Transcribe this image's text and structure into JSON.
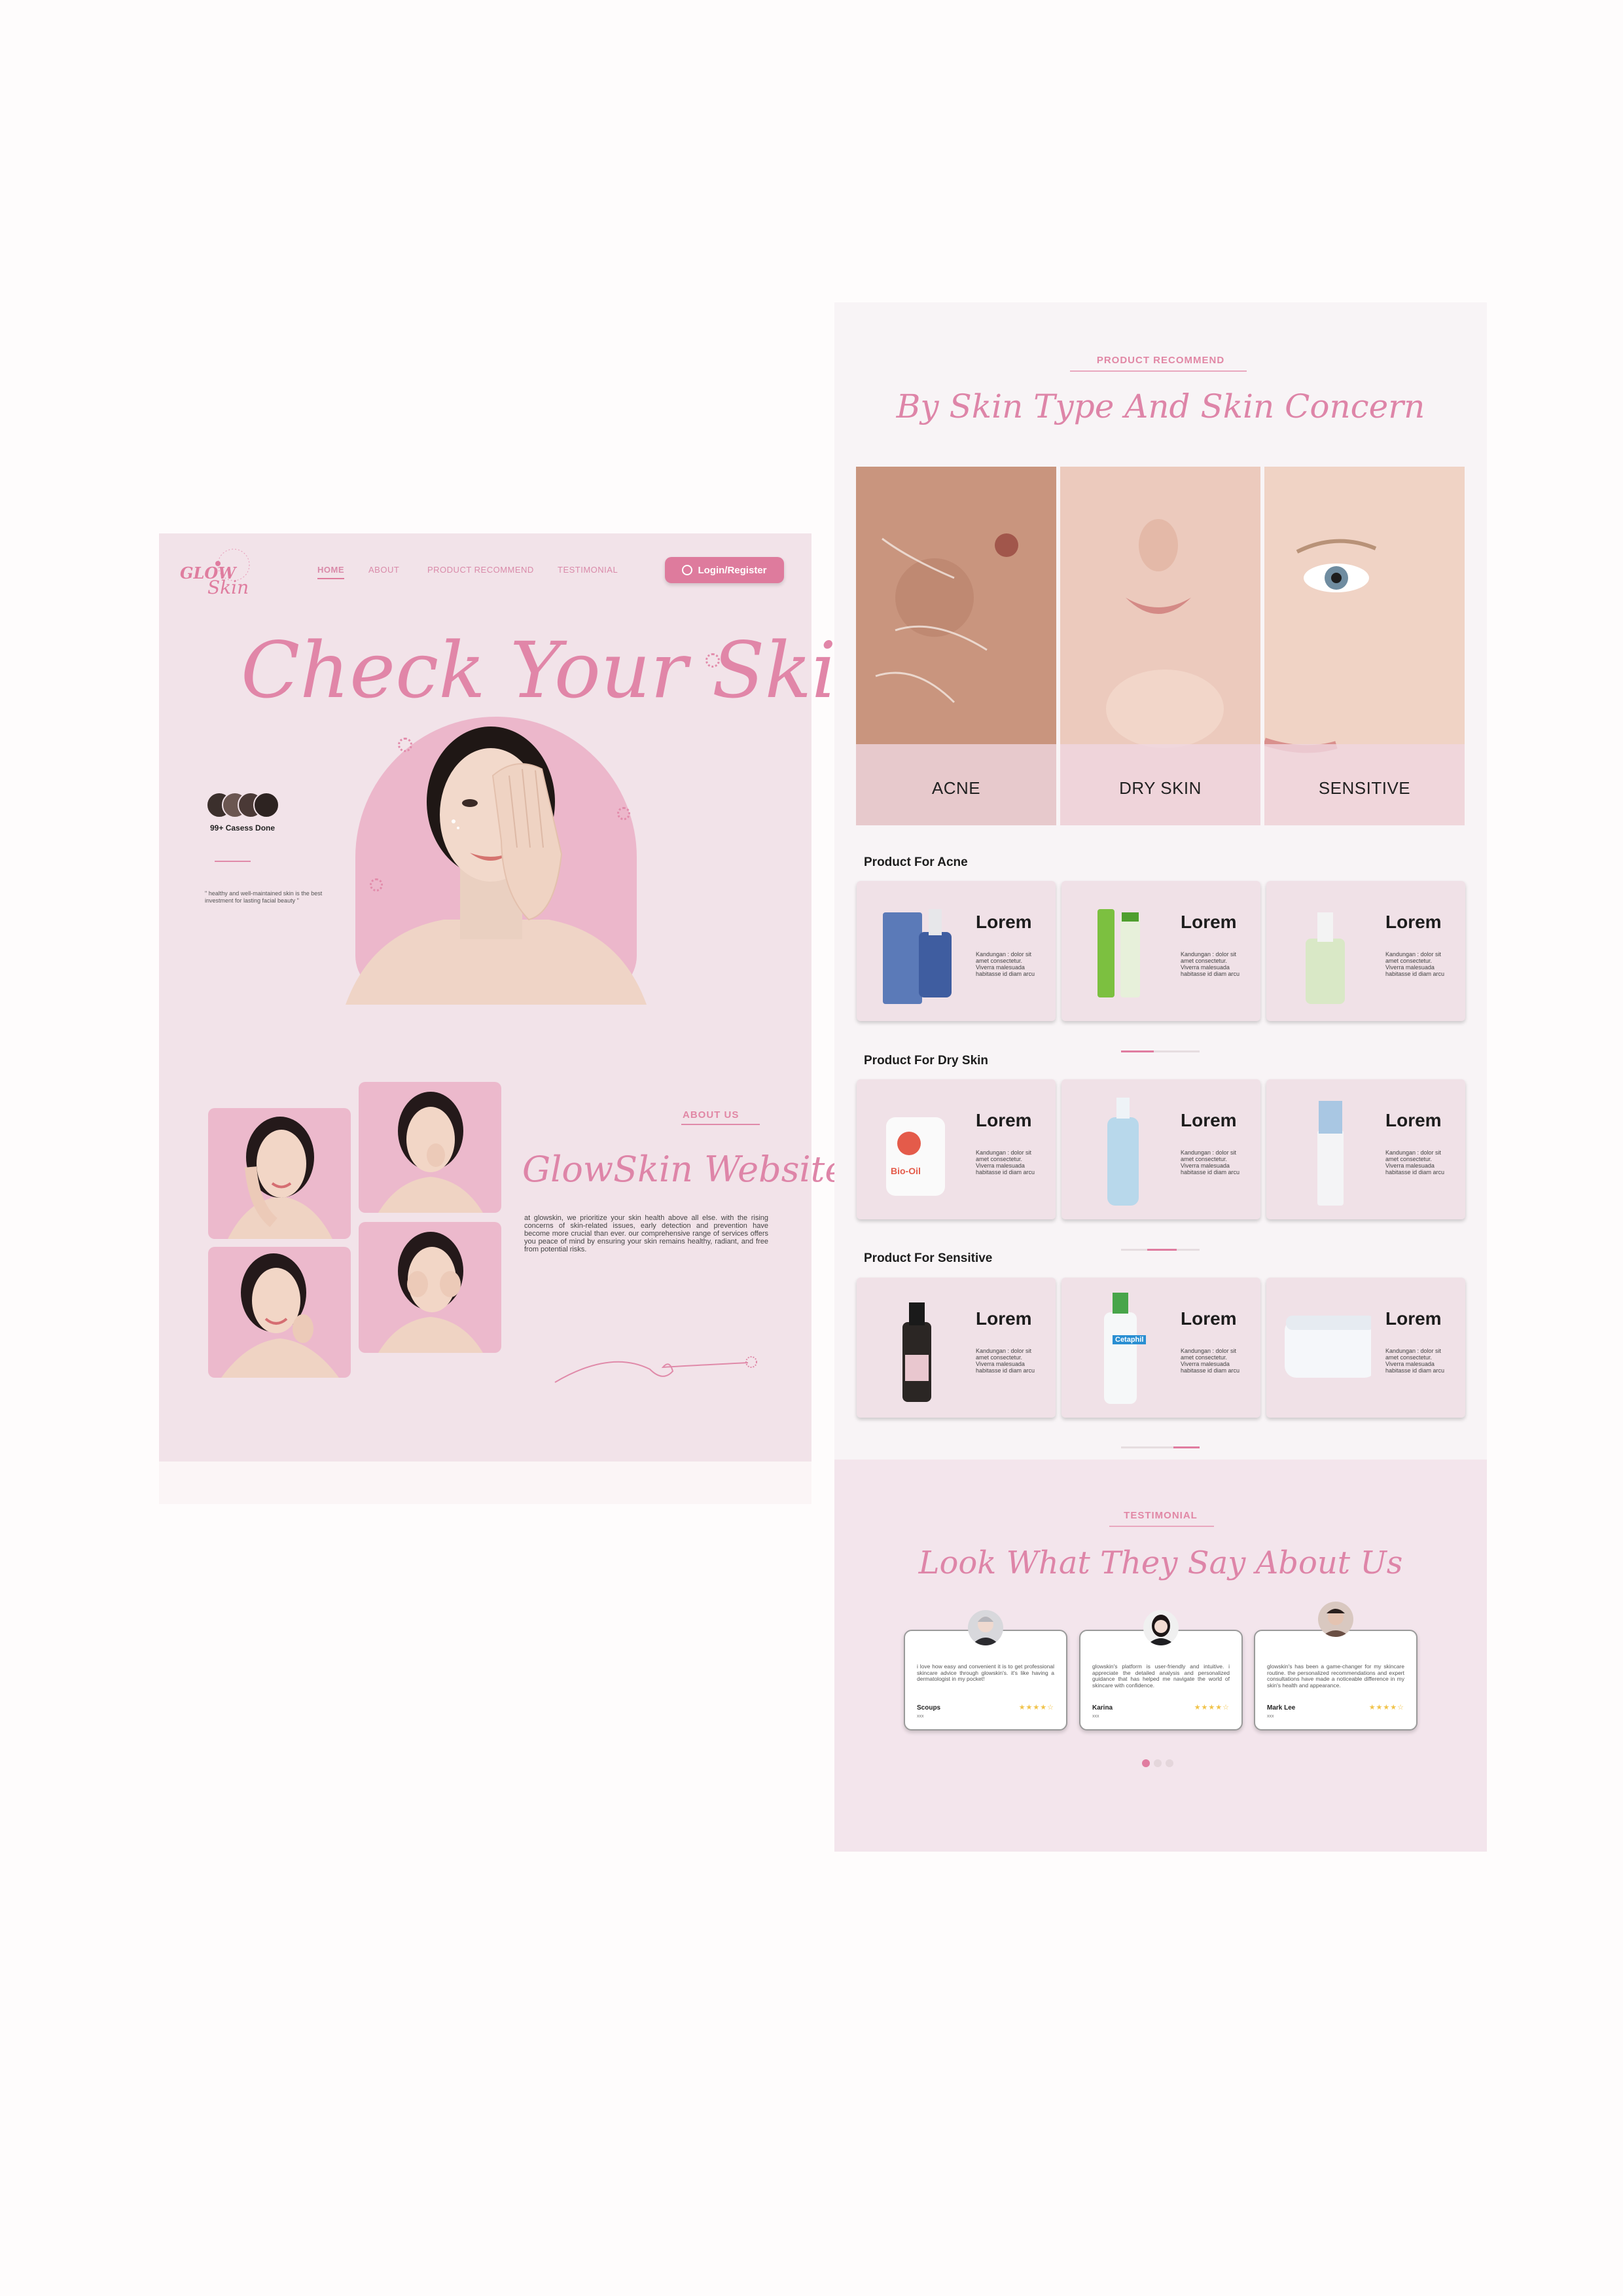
{
  "landing": {
    "logo": {
      "line1": "GLOW",
      "line2": "Skin",
      "ring_text": "SKIN CARE"
    },
    "nav": [
      {
        "label": "HOME",
        "active": true
      },
      {
        "label": "ABOUT",
        "active": false
      },
      {
        "label": "PRODUCT RECOMMEND",
        "active": false
      },
      {
        "label": "TESTIMONIAL",
        "active": false
      }
    ],
    "login_button": "Login/Register",
    "hero_title": "Check Your Skin",
    "cases_done": "99+ Casess Done",
    "quote": "\" healthy and well-maintained skin is the best investment for lasting facial beauty \"",
    "about": {
      "label": "ABOUT US",
      "title": "GlowSkin Website",
      "text": "at glowskin, we prioritize your skin health above all else. with the rising concerns of skin-related issues, early detection and prevention have become more crucial than ever. our comprehensive range of services offers you peace of mind by ensuring your skin remains healthy, radiant, and free from potential risks."
    }
  },
  "recommend": {
    "label": "PRODUCT RECOMMEND",
    "title": "By Skin Type And Skin Concern",
    "concerns": [
      "ACNE",
      "DRY SKIN",
      "SENSITIVE"
    ],
    "categories": [
      {
        "title": "Product For Acne",
        "products": [
          {
            "name": "Lorem",
            "desc": "Kandungan : dolor sit amet consectetur. Viverra malesuada habitasse id diam arcu"
          },
          {
            "name": "Lorem",
            "desc": "Kandungan : dolor sit amet consectetur. Viverra malesuada habitasse id diam arcu"
          },
          {
            "name": "Lorem",
            "desc": "Kandungan : dolor sit amet consectetur. Viverra malesuada habitasse id diam arcu"
          }
        ]
      },
      {
        "title": "Product For Dry Skin",
        "products": [
          {
            "name": "Lorem",
            "desc": "Kandungan : dolor sit amet consectetur. Viverra malesuada habitasse id diam arcu"
          },
          {
            "name": "Lorem",
            "desc": "Kandungan : dolor sit amet consectetur. Viverra malesuada habitasse id diam arcu"
          },
          {
            "name": "Lorem",
            "desc": "Kandungan : dolor sit amet consectetur. Viverra malesuada habitasse id diam arcu"
          }
        ]
      },
      {
        "title": "Product For Sensitive",
        "products": [
          {
            "name": "Lorem",
            "desc": "Kandungan : dolor sit amet consectetur. Viverra malesuada habitasse id diam arcu"
          },
          {
            "name": "Lorem",
            "desc": "Kandungan : dolor sit amet consectetur. Viverra malesuada habitasse id diam arcu"
          },
          {
            "name": "Lorem",
            "desc": "Kandungan : dolor sit amet consectetur. Viverra malesuada habitasse id diam arcu"
          }
        ]
      }
    ],
    "product_labels": {
      "bio_oil": "Bio-Oil",
      "cetaphil": "Cetaphil"
    }
  },
  "testimonial": {
    "label": "TESTIMONIAL",
    "title": "Look What They Say About Us",
    "items": [
      {
        "text": "i love how easy and convenient it is to get professional skincare advice through glowskin's. it's like having a dermatologist in my pocket!",
        "name": "Scoups",
        "sub": "xxx",
        "stars": "★★★★☆"
      },
      {
        "text": "glowskin's platform is user-friendly and intuitive. i appreciate the detailed analysis and personalized guidance that has helped me navigate the world of skincare with confidence.",
        "name": "Karina",
        "sub": "xxx",
        "stars": "★★★★☆"
      },
      {
        "text": "glowskin's has been a game-changer for my skincare routine. the personalized recommendations and expert consultations have made a noticeable difference in my skin's health and appearance.",
        "name": "Mark Lee",
        "sub": "xxx",
        "stars": "★★★★☆"
      }
    ]
  },
  "colors": {
    "accent": "#de7b9d",
    "panel": "#f2e3e9",
    "script": "#de85a8"
  }
}
